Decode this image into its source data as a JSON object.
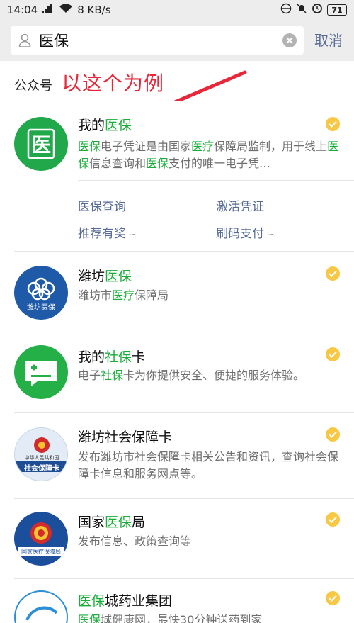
{
  "status_bar": {
    "time": "14:04",
    "signal": "ᵍˡ",
    "network_speed": "8 KB/s",
    "battery": "71"
  },
  "search": {
    "query": "医保",
    "cancel_label": "取消"
  },
  "section": {
    "label": "公众号",
    "annotation": "以这个为例"
  },
  "results": [
    {
      "title_parts": [
        "我的",
        "医保"
      ],
      "desc_parts": [
        "医保",
        "电子凭证是由国家",
        "医疗",
        "保障局监制，用于线上",
        "医保",
        "信息查询和",
        "医保",
        "支付的唯一电子凭…"
      ],
      "menu": {
        "left_top": "医保查询",
        "right_top": "激活凭证",
        "left_bottom": "推荐有奖",
        "right_bottom": "刷码支付"
      },
      "avatar_char": "医"
    },
    {
      "title_parts": [
        "潍坊",
        "医保"
      ],
      "desc_parts": [
        "潍坊市",
        "医疗",
        "保障局"
      ],
      "avatar_text": "潍坊医保"
    },
    {
      "title_parts": [
        "我的",
        "社保",
        "卡"
      ],
      "desc_parts": [
        "电子",
        "社保",
        "卡为你提供安全、便捷的服务体验。"
      ]
    },
    {
      "title_parts": [
        "潍坊社会保障卡"
      ],
      "desc_parts": [
        "发布潍坊市社会保障卡相关公告和资讯，查询社会保障卡信息和服务网点等。"
      ],
      "avatar_text_top": "中华人民共和国",
      "avatar_text_bottom": "社会保障卡"
    },
    {
      "title_parts": [
        "国家",
        "医保",
        "局"
      ],
      "desc_parts": [
        "发布信息、政策查询等"
      ],
      "avatar_text": "国家医疗保障局"
    },
    {
      "title_parts": [
        "医保",
        "城药业集团"
      ],
      "desc_parts": [
        "医保",
        "城健康网，最快30分钟送药到家"
      ]
    }
  ],
  "colors": {
    "highlight": "#1aad3a",
    "link": "#576b95",
    "annotation": "#e8283a",
    "verified": "#f7c846"
  }
}
